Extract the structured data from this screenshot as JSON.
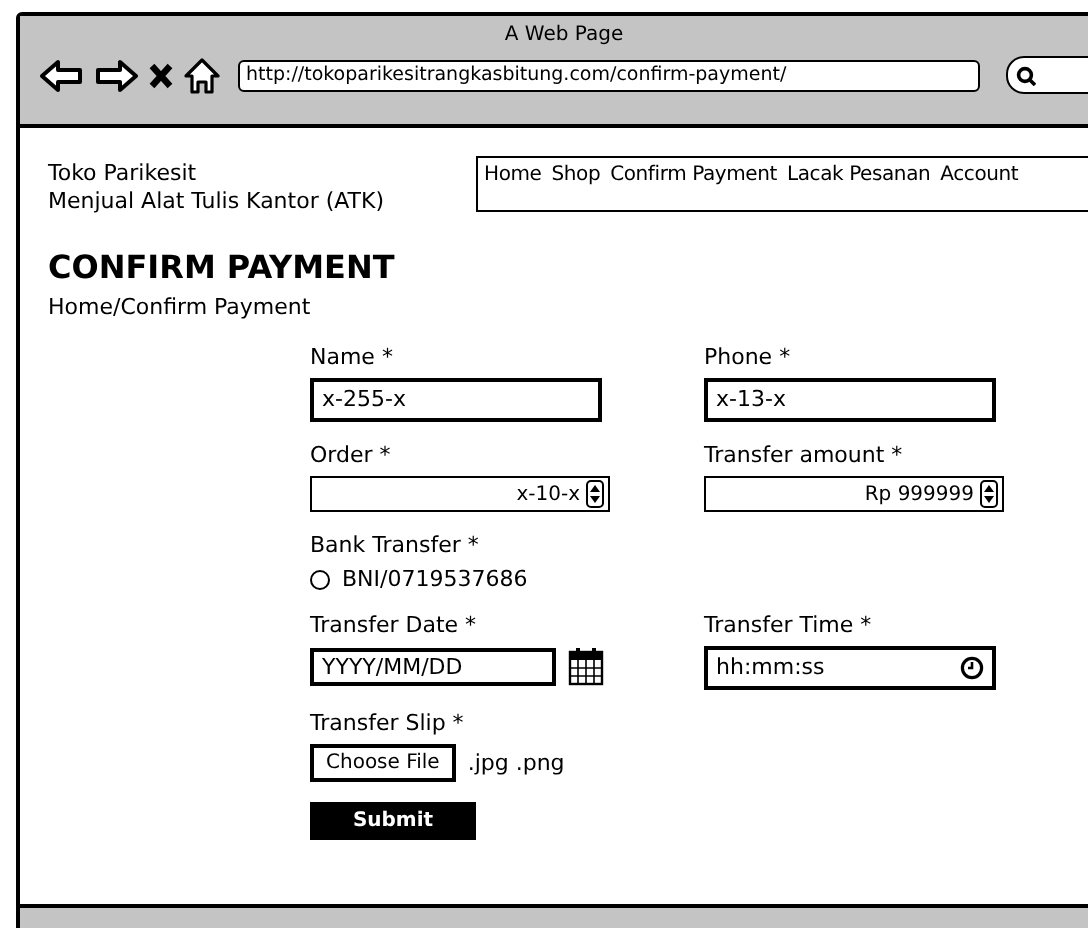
{
  "window": {
    "title": "A Web Page"
  },
  "address_bar": {
    "url": "http://tokoparikesitrangkasbitung.com/confirm-payment/"
  },
  "site": {
    "name": "Toko Parikesit",
    "tagline": "Menjual Alat Tulis Kantor (ATK)"
  },
  "nav": {
    "items": [
      "Home",
      "Shop",
      "Confirm Payment",
      "Lacak Pesanan",
      "Account"
    ]
  },
  "page": {
    "heading": "CONFIRM PAYMENT",
    "breadcrumb": "Home/Confirm Payment"
  },
  "form": {
    "fields": [
      {
        "kind": "text",
        "label": "Name *",
        "value": "x-255-x"
      },
      {
        "kind": "text",
        "label": "Phone *",
        "value": "x-13-x"
      },
      {
        "kind": "spinner",
        "label": "Order *",
        "value": "x-10-x"
      },
      {
        "kind": "spinner",
        "label": "Transfer amount *",
        "value": "Rp 999999"
      },
      {
        "kind": "radio",
        "label": "Bank Transfer *",
        "options": [
          {
            "label": "BNI/0719537686",
            "selected": false
          }
        ]
      },
      {
        "kind": "date",
        "label": "Transfer Date *",
        "placeholder": "YYYY/MM/DD"
      },
      {
        "kind": "time",
        "label": "Transfer Time *",
        "placeholder": "hh:mm:ss"
      },
      {
        "kind": "file",
        "label": "Transfer Slip *",
        "button": "Choose File",
        "hint": ".jpg .png"
      }
    ],
    "submit": "Submit"
  }
}
